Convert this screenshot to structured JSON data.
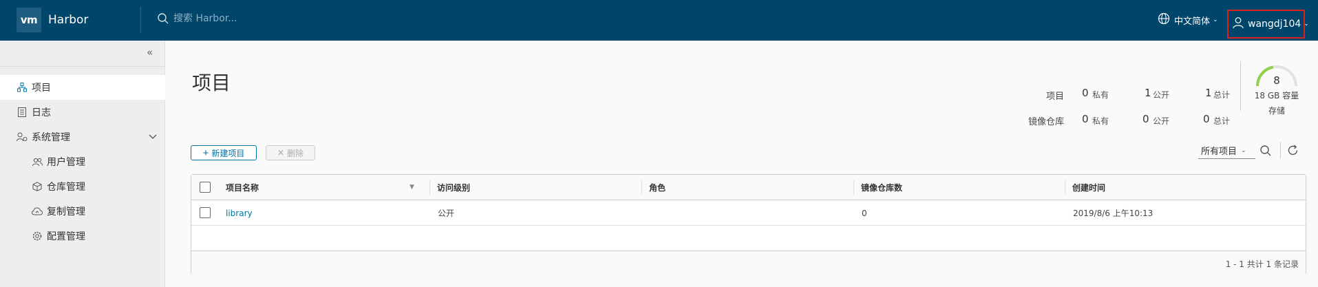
{
  "header": {
    "logo_text": "vm",
    "app_name": "Harbor",
    "search_placeholder": "搜索 Harbor...",
    "language": "中文简体",
    "username": "wangdj104"
  },
  "sidebar": {
    "items": [
      {
        "label": "项目",
        "icon": "projects-icon",
        "active": true
      },
      {
        "label": "日志",
        "icon": "log-icon"
      },
      {
        "label": "系统管理",
        "icon": "admin-icon",
        "expanded": true
      },
      {
        "label": "用户管理",
        "icon": "users-icon"
      },
      {
        "label": "仓库管理",
        "icon": "box-icon"
      },
      {
        "label": "复制管理",
        "icon": "cloud-sync-icon"
      },
      {
        "label": "配置管理",
        "icon": "gear-icon"
      }
    ]
  },
  "main": {
    "title": "项目",
    "stats": {
      "projects_label": "项目",
      "repos_label": "镜像仓库",
      "private_unit": "私有",
      "public_unit": "公开",
      "total_unit": "总计",
      "projects": {
        "private": "0",
        "public": "1",
        "total": "1"
      },
      "repos": {
        "private": "0",
        "public": "0",
        "total": "0"
      }
    },
    "storage": {
      "value": "8",
      "capacity": "18 GB 容量",
      "label": "存储",
      "fill_fraction": 0.44,
      "color": "#8fd14f"
    },
    "toolbar": {
      "new_label": "新建项目",
      "delete_label": "删除",
      "filter_value": "所有项目"
    },
    "table": {
      "columns": [
        "项目名称",
        "访问级别",
        "角色",
        "镜像仓库数",
        "创建时间"
      ],
      "rows": [
        {
          "name": "library",
          "access": "公开",
          "role": "",
          "repo_count": "0",
          "created": "2019/8/6 上午10:13"
        }
      ],
      "footer": "1 - 1 共计 1 条记录"
    }
  },
  "colors": {
    "header_bg": "#00456a",
    "link": "#0072a3",
    "highlight_border": "#e02020"
  }
}
